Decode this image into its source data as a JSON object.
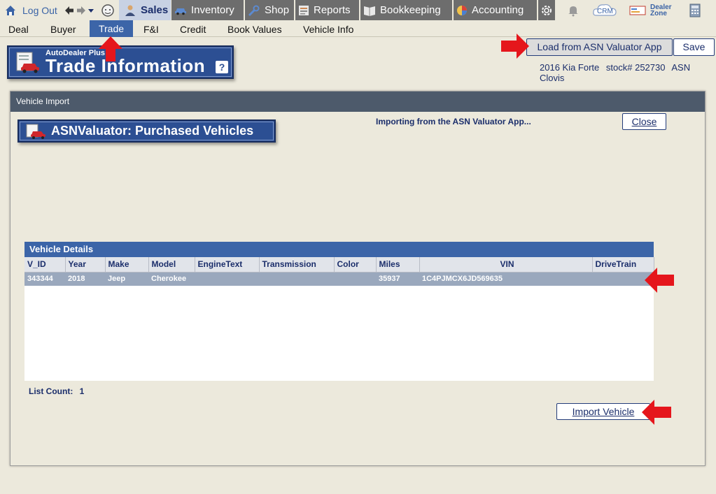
{
  "topbar": {
    "logout": "Log Out",
    "tabs": [
      {
        "label": "Sales",
        "icon": "salesperson-icon"
      },
      {
        "label": "Inventory",
        "icon": "car-icon"
      },
      {
        "label": "Shop",
        "icon": "wrench-icon"
      },
      {
        "label": "Reports",
        "icon": "report-icon"
      },
      {
        "label": "Bookkeeping",
        "icon": "book-icon"
      },
      {
        "label": "Accounting",
        "icon": "pie-chart-icon"
      }
    ],
    "crm": "CRM",
    "dealer_zone_line1": "Dealer",
    "dealer_zone_line2": "Zone"
  },
  "subnav": {
    "items": [
      "Deal",
      "Buyer",
      "Trade",
      "F&I",
      "Credit",
      "Book Values",
      "Vehicle Info"
    ],
    "active": "Trade"
  },
  "header": {
    "brand": "AutoDealer Plus",
    "title": "Trade Information",
    "help": "?",
    "load_button": "Load from ASN Valuator App",
    "save_button": "Save",
    "vehicle": "2016 Kia Forte",
    "stock": "stock# 252730",
    "location": "ASN Clovis"
  },
  "dialog": {
    "title": "Vehicle Import",
    "badge": "ASNValuator: Purchased Vehicles",
    "status": "Importing from the ASN Valuator App...",
    "close_button": "Close",
    "grid_title": "Vehicle Details",
    "columns": [
      "V_ID",
      "Year",
      "Make",
      "Model",
      "EngineText",
      "Transmission",
      "Color",
      "Miles",
      "VIN",
      "DriveTrain"
    ],
    "rows": [
      {
        "V_ID": "343344",
        "Year": "2018",
        "Make": "Jeep",
        "Model": "Cherokee",
        "EngineText": "",
        "Transmission": "",
        "Color": "",
        "Miles": "35937",
        "VIN": "1C4PJMCX6JD569635",
        "DriveTrain": ""
      }
    ],
    "list_count_label": "List Count:",
    "list_count_value": "1",
    "import_button": "Import Vehicle"
  },
  "colors": {
    "nav_active": "#3c65a8",
    "badge_blue": "#2c4f93",
    "annotation_red": "#e5161c"
  }
}
